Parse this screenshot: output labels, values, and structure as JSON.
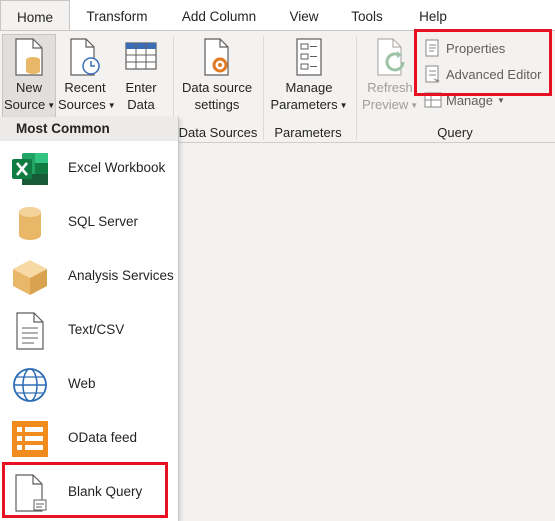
{
  "tabs": [
    "Home",
    "Transform",
    "Add Column",
    "View",
    "Tools",
    "Help"
  ],
  "ribbon": {
    "new_source": {
      "line1": "New",
      "line2": "Source"
    },
    "recent_sources": {
      "line1": "Recent",
      "line2": "Sources"
    },
    "enter_data": {
      "line1": "Enter",
      "line2": "Data"
    },
    "data_source_settings": {
      "line1": "Data source",
      "line2": "settings"
    },
    "manage_parameters": {
      "line1": "Manage",
      "line2": "Parameters"
    },
    "refresh_preview": {
      "line1": "Refresh",
      "line2": "Preview"
    },
    "properties": "Properties",
    "advanced_editor": "Advanced Editor",
    "manage": "Manage",
    "groups": {
      "data_sources": "Data Sources",
      "parameters": "Parameters",
      "query": "Query"
    }
  },
  "menu": {
    "header": "Most Common",
    "items": [
      {
        "label": "Excel Workbook",
        "icon": "excel-icon"
      },
      {
        "label": "SQL Server",
        "icon": "database-icon"
      },
      {
        "label": "Analysis Services",
        "icon": "cube-icon"
      },
      {
        "label": "Text/CSV",
        "icon": "text-file-icon"
      },
      {
        "label": "Web",
        "icon": "globe-icon"
      },
      {
        "label": "OData feed",
        "icon": "odata-icon"
      },
      {
        "label": "Blank Query",
        "icon": "blank-query-icon"
      }
    ]
  },
  "colors": {
    "highlight": "#e81123",
    "excel": "#1d6f42",
    "database": "#e8b868",
    "odata": "#f28b1e",
    "globe": "#2c6db5"
  }
}
